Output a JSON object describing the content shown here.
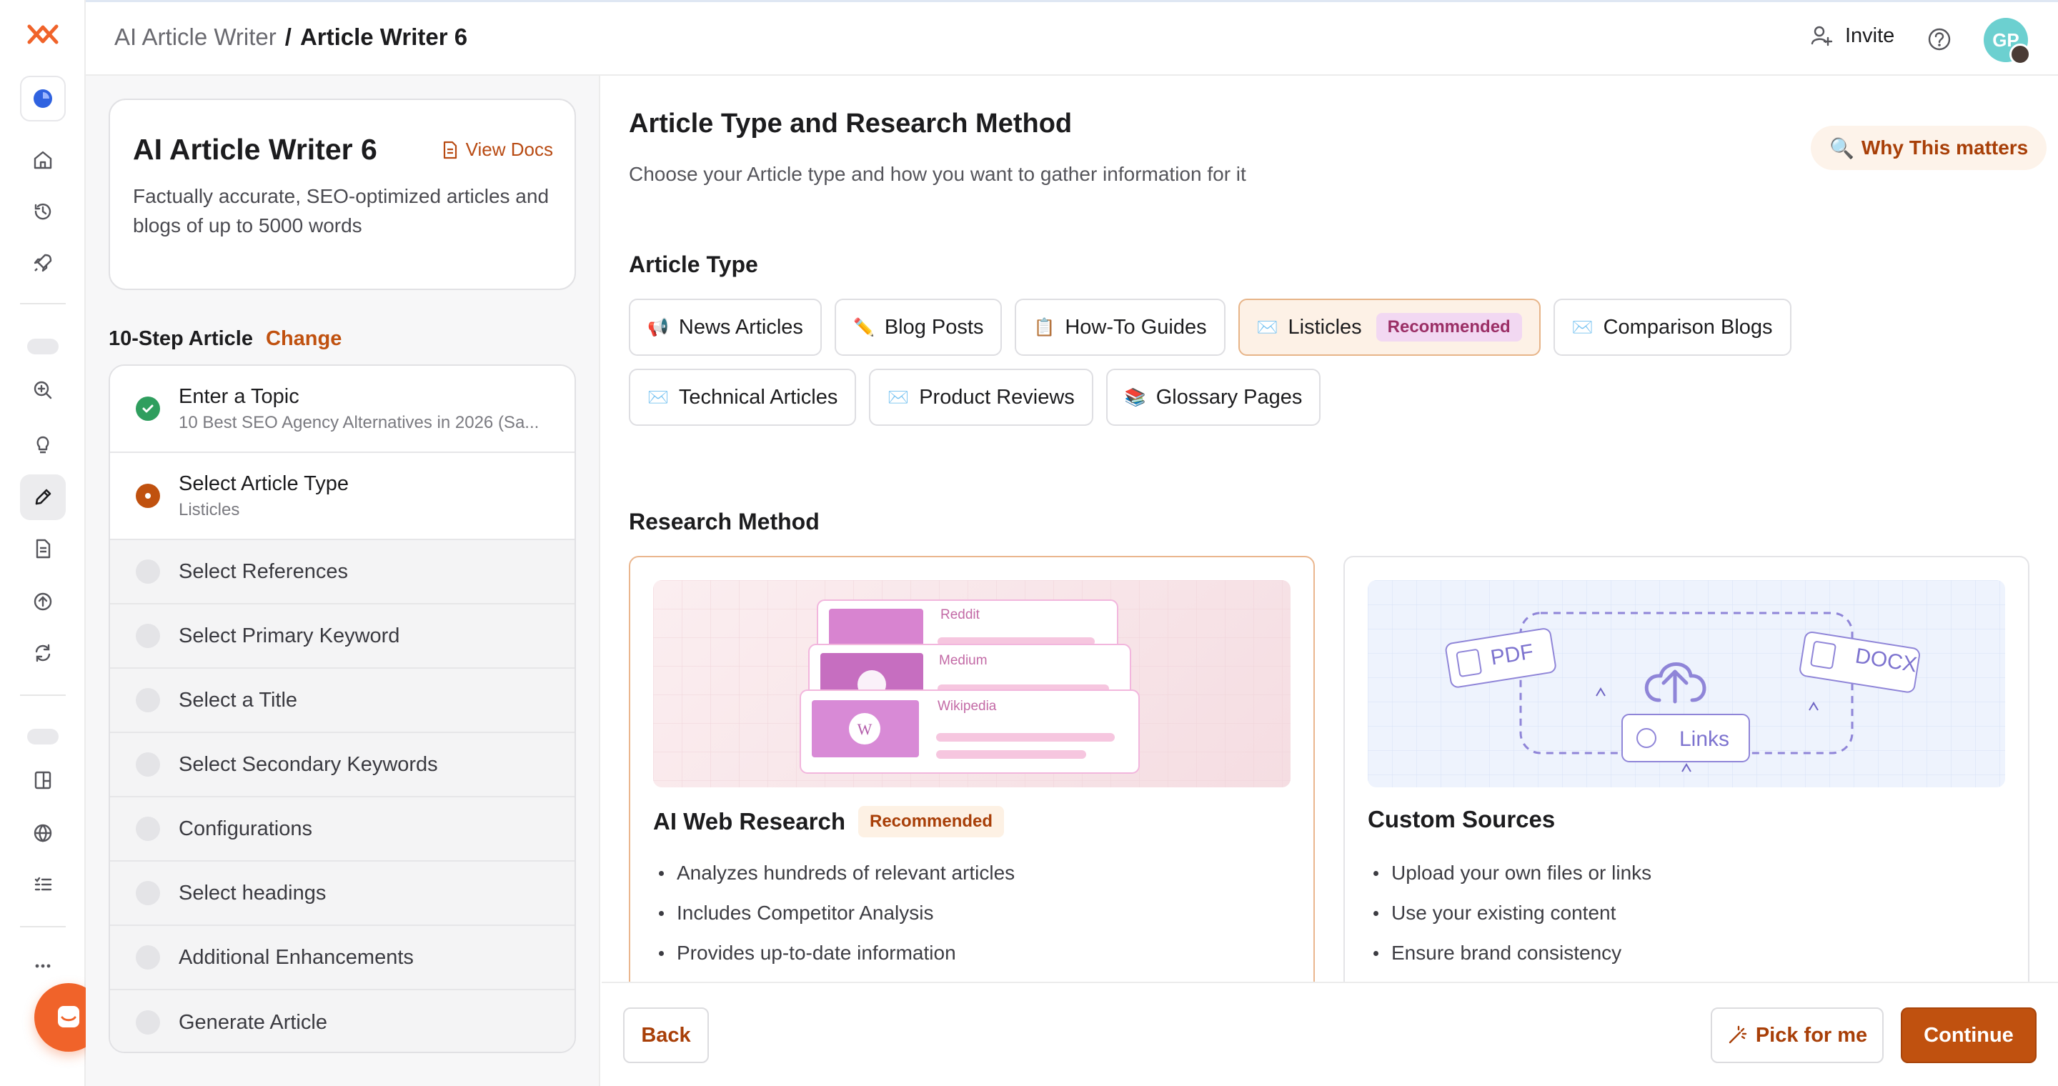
{
  "breadcrumb": {
    "parent": "AI Article Writer",
    "separator": "/",
    "current": "Article Writer 6"
  },
  "header": {
    "invite_label": "Invite",
    "avatar_initials": "GP"
  },
  "info_card": {
    "title": "AI Article Writer 6",
    "docs_label": "View Docs",
    "description": "Factually accurate, SEO-optimized articles and blogs of up to 5000 words"
  },
  "steps_header": {
    "label": "10-Step Article",
    "change_label": "Change"
  },
  "steps": [
    {
      "label": "Enter a Topic",
      "sub": "10 Best SEO Agency Alternatives in 2026 (Sa...",
      "state": "done"
    },
    {
      "label": "Select Article Type",
      "sub": "Listicles",
      "state": "active"
    },
    {
      "label": "Select References",
      "sub": "",
      "state": "pending"
    },
    {
      "label": "Select Primary Keyword",
      "sub": "",
      "state": "pending"
    },
    {
      "label": "Select a Title",
      "sub": "",
      "state": "pending"
    },
    {
      "label": "Select Secondary Keywords",
      "sub": "",
      "state": "pending"
    },
    {
      "label": "Configurations",
      "sub": "",
      "state": "pending"
    },
    {
      "label": "Select headings",
      "sub": "",
      "state": "pending"
    },
    {
      "label": "Additional Enhancements",
      "sub": "",
      "state": "pending"
    },
    {
      "label": "Generate Article",
      "sub": "",
      "state": "pending"
    }
  ],
  "main": {
    "title": "Article Type and Research Method",
    "subtitle": "Choose your Article type and how you want to gather information for it",
    "why_label": "Why This matters",
    "article_type_heading": "Article Type",
    "research_heading": "Research Method"
  },
  "article_types": [
    {
      "label": "News Articles",
      "emoji": "📢",
      "selected": false,
      "badge": ""
    },
    {
      "label": "Blog Posts",
      "emoji": "✏️",
      "selected": false,
      "badge": ""
    },
    {
      "label": "How-To Guides",
      "emoji": "📋",
      "selected": false,
      "badge": ""
    },
    {
      "label": "Listicles",
      "emoji": "✉️",
      "selected": true,
      "badge": "Recommended"
    },
    {
      "label": "Comparison Blogs",
      "emoji": "✉️",
      "selected": false,
      "badge": ""
    },
    {
      "label": "Technical Articles",
      "emoji": "✉️",
      "selected": false,
      "badge": ""
    },
    {
      "label": "Product Reviews",
      "emoji": "✉️",
      "selected": false,
      "badge": ""
    },
    {
      "label": "Glossary Pages",
      "emoji": "📚",
      "selected": false,
      "badge": ""
    }
  ],
  "research_methods": [
    {
      "title": "AI Web Research",
      "badge": "Recommended",
      "selected": true,
      "illustration_labels": [
        "Reddit",
        "Medium",
        "Wikipedia"
      ],
      "bullets": [
        "Analyzes hundreds of relevant articles",
        "Includes Competitor Analysis",
        "Provides up-to-date information"
      ]
    },
    {
      "title": "Custom Sources",
      "badge": "",
      "selected": false,
      "illustration_labels": [
        "PDF",
        "DOCX",
        "Links"
      ],
      "bullets": [
        "Upload your own files or links",
        "Use your existing content",
        "Ensure brand consistency"
      ]
    }
  ],
  "footer": {
    "back_label": "Back",
    "pick_label": "Pick for me",
    "continue_label": "Continue"
  },
  "colors": {
    "accent": "#c0510f",
    "success": "#2f9e5e",
    "rec_badge_bg": "#f2d8f2"
  }
}
